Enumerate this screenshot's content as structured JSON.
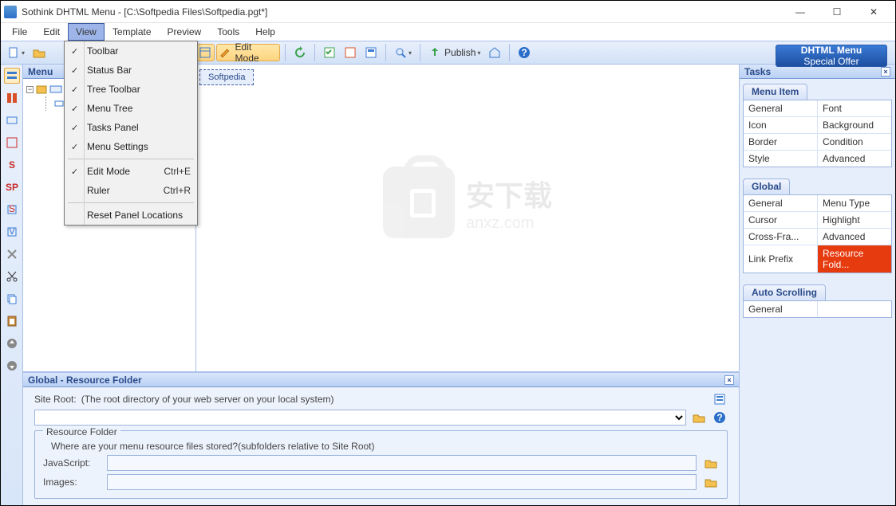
{
  "window": {
    "title": "Sothink DHTML Menu - [C:\\Softpedia Files\\Softpedia.pgt*]"
  },
  "menubar": [
    {
      "label": "File",
      "underline": "F"
    },
    {
      "label": "Edit",
      "underline": "E"
    },
    {
      "label": "View",
      "underline": "V",
      "active": true
    },
    {
      "label": "Template",
      "underline": "T"
    },
    {
      "label": "Preview",
      "underline": "P"
    },
    {
      "label": "Tools",
      "underline": "T"
    },
    {
      "label": "Help",
      "underline": "H"
    }
  ],
  "view_menu": {
    "items": [
      {
        "label": "Toolbar",
        "checked": true,
        "underline": "T"
      },
      {
        "label": "Status Bar",
        "checked": true,
        "underline": "S"
      },
      {
        "label": "Tree Toolbar",
        "checked": true,
        "underline": "r"
      },
      {
        "label": "Menu Tree",
        "checked": true,
        "underline": "M"
      },
      {
        "label": "Tasks Panel",
        "checked": true,
        "underline": ""
      },
      {
        "label": "Menu Settings",
        "checked": true,
        "underline": "n"
      },
      {
        "sep": true
      },
      {
        "label": "Edit Mode",
        "checked": true,
        "shortcut": "Ctrl+E",
        "underline": "E"
      },
      {
        "label": "Ruler",
        "checked": false,
        "shortcut": "Ctrl+R",
        "underline": ""
      },
      {
        "sep": true
      },
      {
        "label": "Reset Panel Locations",
        "checked": false,
        "underline": "L"
      }
    ]
  },
  "toolbar": {
    "edit_mode_label": "Edit Mode",
    "publish_label": "Publish"
  },
  "promo": {
    "line1": "DHTML Menu",
    "line2": "Special Offer"
  },
  "tree_panel": {
    "title": "Menu",
    "root_icon": "folder",
    "child_label": "..."
  },
  "design": {
    "item_label": "Softpedia"
  },
  "watermark": {
    "big": "安下载",
    "small": "anxz.com"
  },
  "bottom_panel": {
    "title": "Global - Resource Folder",
    "site_root_label": "Site Root:",
    "site_root_hint": "(The root directory of your web server on your local system)",
    "site_root_value": "",
    "fieldset_title": "Resource Folder",
    "hint": "Where are your menu resource files stored?(subfolders relative to Site Root)",
    "js_label": "JavaScript:",
    "js_value": "",
    "img_label": "Images:",
    "img_value": ""
  },
  "tasks": {
    "title": "Tasks",
    "menu_item": {
      "tab": "Menu Item",
      "rows": [
        [
          "General",
          "Font"
        ],
        [
          "Icon",
          "Background"
        ],
        [
          "Border",
          "Condition"
        ],
        [
          "Style",
          "Advanced"
        ]
      ]
    },
    "global": {
      "tab": "Global",
      "rows": [
        [
          "General",
          "Menu Type"
        ],
        [
          "Cursor",
          "Highlight"
        ],
        [
          "Cross-Fra...",
          "Advanced"
        ],
        [
          "Link Prefix",
          "Resource Fold..."
        ]
      ],
      "selected": [
        3,
        1
      ]
    },
    "auto_scrolling": {
      "tab": "Auto Scrolling",
      "rows": [
        [
          "General",
          ""
        ]
      ]
    }
  }
}
